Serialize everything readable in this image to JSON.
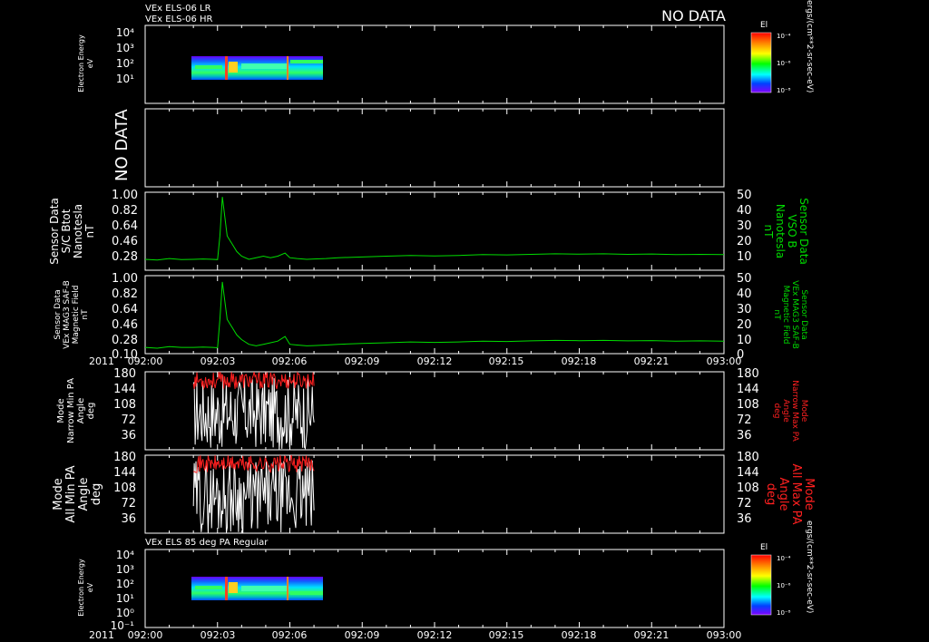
{
  "header": {
    "line1": "VEx ELS-06 LR",
    "line2": "VEx ELS-06 HR",
    "no_data": "NO DATA"
  },
  "time_axis": {
    "year": "2011",
    "ticks": [
      "092:00",
      "092:03",
      "092:06",
      "092:09",
      "092:12",
      "092:15",
      "092:18",
      "092:21",
      "093:00"
    ]
  },
  "colorbar": {
    "title": "El",
    "unit": "ergs/(cm**2-sr-sec-eV)",
    "tick_top": "10⁻⁴",
    "tick_mid": "10⁻⁶",
    "tick_bot": "10⁻⁸"
  },
  "chart_data": [
    {
      "type": "heatmap",
      "panel": "spectrogram-top",
      "ylabel": [
        "Electron Energy",
        "eV"
      ],
      "yticks": [
        "10⁴",
        "10³",
        "10²",
        "10¹"
      ],
      "data_span": [
        "092:02",
        "092:07"
      ]
    },
    {
      "type": "line",
      "panel": "no-data",
      "label": "NO DATA"
    },
    {
      "type": "line",
      "panel": "sensor-vso-b",
      "ylabel_left": [
        "Sensor Data",
        "S/C Btot",
        "Nanotesla",
        "nT"
      ],
      "ylabel_right": [
        "Sensor Data",
        "VSO B",
        "Nanotesla",
        "nT"
      ],
      "yticks_left": [
        "1.00",
        "0.82",
        "0.64",
        "0.46",
        "0.28"
      ],
      "yticks_right": [
        "50",
        "40",
        "30",
        "20",
        "10"
      ],
      "ylim": [
        0,
        50
      ],
      "series": [
        {
          "color": "#00dd00",
          "x": [
            0,
            0.5,
            1,
            1.5,
            2,
            2.4,
            2.8,
            3.0,
            3.1,
            3.2,
            3.4,
            3.6,
            3.8,
            4.0,
            4.3,
            4.6,
            4.9,
            5.2,
            5.5,
            5.8,
            6.0,
            6.3,
            6.7,
            7.0,
            7.5,
            8,
            9,
            10,
            11,
            12,
            13,
            14,
            15,
            16,
            17,
            18,
            19,
            20,
            21,
            22,
            23,
            24
          ],
          "y": [
            7,
            6.5,
            7.5,
            6.8,
            7,
            7.2,
            7,
            6.8,
            22,
            47,
            22,
            17,
            12,
            9,
            7,
            8,
            9,
            8,
            9,
            11,
            8,
            7.5,
            7,
            7.2,
            7.5,
            8,
            8.5,
            9,
            9.5,
            9.2,
            9.5,
            10,
            9.8,
            10.2,
            10.5,
            10.3,
            10.5,
            10.2,
            10.4,
            10,
            10.2,
            10
          ]
        }
      ]
    },
    {
      "type": "line",
      "panel": "sensor-mag3",
      "ylabel_left": [
        "Sensor Data",
        "VEx MAG3 SAF-B",
        "Magnetic Field",
        "nT"
      ],
      "ylabel_right": [
        "Sensor Data",
        "VEx MAG3 SAF-B",
        "Magnetic Field",
        "nT"
      ],
      "yticks_left": [
        "1.00",
        "0.82",
        "0.64",
        "0.46",
        "0.28",
        "0.10"
      ],
      "yticks_right": [
        "50",
        "40",
        "30",
        "20",
        "10",
        "0"
      ],
      "ylim": [
        0,
        50
      ],
      "series": [
        {
          "color": "#00dd00",
          "x": [
            0,
            0.5,
            1,
            1.5,
            2,
            2.4,
            2.8,
            3.0,
            3.1,
            3.2,
            3.4,
            3.6,
            3.8,
            4.0,
            4.3,
            4.6,
            4.9,
            5.2,
            5.5,
            5.8,
            6.0,
            6.3,
            6.7,
            7.0,
            7.5,
            8,
            9,
            10,
            11,
            12,
            13,
            14,
            15,
            16,
            17,
            18,
            19,
            20,
            21,
            22,
            23,
            24
          ],
          "y": [
            4,
            3.5,
            4.5,
            4,
            4,
            4.2,
            4,
            3.8,
            22,
            46,
            22,
            17,
            12,
            9,
            6,
            5,
            6,
            7,
            8,
            11,
            6,
            5.5,
            5,
            5.2,
            5.5,
            6,
            6.5,
            7,
            7.5,
            7.2,
            7.5,
            8,
            7.8,
            8.2,
            8.5,
            8.3,
            8.5,
            8.2,
            8.4,
            8,
            8.2,
            8
          ]
        }
      ]
    },
    {
      "type": "line",
      "panel": "pa-narrow",
      "ylabel_left": [
        "Mode",
        "Narrow Min PA",
        "Angle",
        "deg"
      ],
      "ylabel_right": [
        "Mode",
        "Narrow Max PA",
        "Angle",
        "deg"
      ],
      "yticks": [
        "180",
        "144",
        "108",
        "72",
        "36"
      ],
      "ylim": [
        0,
        180
      ],
      "series": [
        {
          "color": "#ffffff",
          "span": [
            "092:02",
            "092:07"
          ],
          "range": [
            0,
            170
          ]
        },
        {
          "color": "#ff2020",
          "span": [
            "092:02",
            "092:07"
          ],
          "range": [
            140,
            180
          ]
        }
      ]
    },
    {
      "type": "line",
      "panel": "pa-all",
      "ylabel_left": [
        "Mode",
        "All Min PA",
        "Angle",
        "deg"
      ],
      "ylabel_right": [
        "Mode",
        "All Max PA",
        "Angle",
        "deg"
      ],
      "yticks": [
        "180",
        "144",
        "108",
        "72",
        "36"
      ],
      "ylim": [
        0,
        180
      ],
      "series": [
        {
          "color": "#ffffff",
          "span": [
            "092:02",
            "092:07"
          ],
          "range": [
            0,
            170
          ]
        },
        {
          "color": "#ff2020",
          "span": [
            "092:02",
            "092:07"
          ],
          "range": [
            140,
            180
          ]
        }
      ]
    },
    {
      "type": "heatmap",
      "panel": "spectrogram-bottom",
      "title": "VEx ELS 85 deg PA Regular",
      "ylabel": [
        "Electron Energy",
        "eV"
      ],
      "yticks": [
        "10⁴",
        "10³",
        "10²",
        "10¹",
        "10⁰",
        "10⁻¹"
      ],
      "data_span": [
        "092:02",
        "092:07"
      ]
    }
  ]
}
